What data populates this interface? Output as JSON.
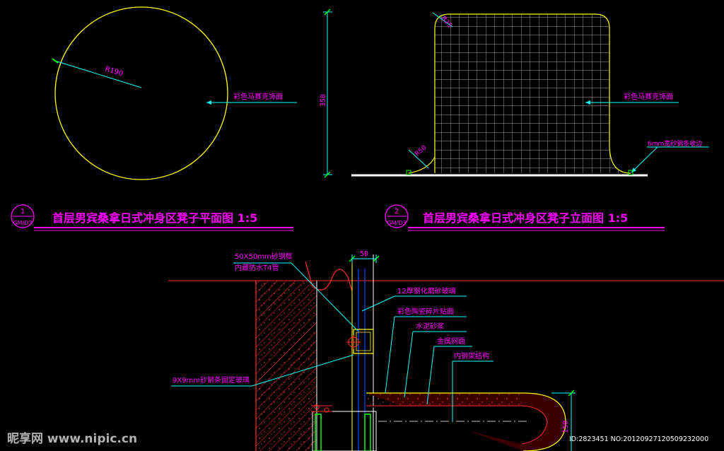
{
  "plan": {
    "radius_label": "R190",
    "finish_label": "彩色马赛克饰面"
  },
  "elevation": {
    "height_label": "350",
    "corner_label_top": "R25",
    "corner_label_bottom": "R50",
    "finish_label": "彩色马赛克饰面",
    "edge_label": "6mm宽砂钢条收边"
  },
  "titles": {
    "plan": {
      "number": "1",
      "sheet": "GM/D3",
      "text": "首层男宾桑拿日式冲身区凳子平面图  1:5"
    },
    "elevation": {
      "number": "2",
      "sheet": "GM/D3",
      "text": "首层男宾桑拿日式冲身区凳子立面图  1:5"
    }
  },
  "section": {
    "dim_top": "50",
    "dim_right": "150",
    "labels": [
      "50X50mm砂钢框",
      "内藏防水T4管",
      "12厚钢化磨砂玻璃",
      "彩色陶瓷碎片贴面",
      "水泥砂浆",
      "金属网面",
      "内钢架结构",
      "9X9mm砂钢条固定玻璃"
    ]
  },
  "watermark": {
    "logo": "昵享网 www.nipic.cn",
    "id": "ID:2823451 NO:20120927120509232000"
  },
  "colors": {
    "background": "#000000",
    "yellow": "#ffff00",
    "magenta": "#ff00ff",
    "cyan": "#00ffff",
    "white": "#ffffff",
    "red": "#ff2a2a",
    "grid": "#cfcfcf",
    "green": "#00ff00"
  }
}
